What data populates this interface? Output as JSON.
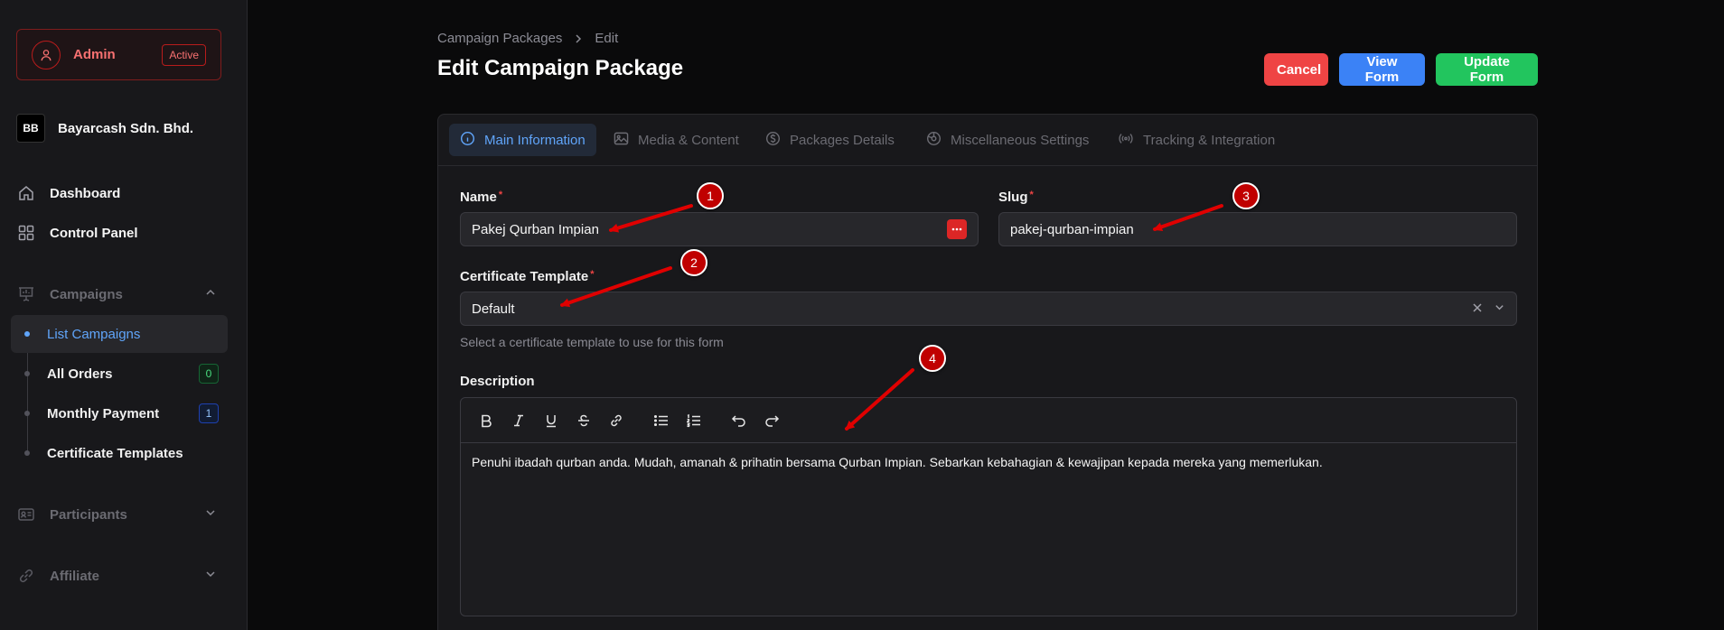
{
  "sidebar": {
    "admin": {
      "name": "Admin",
      "status": "Active"
    },
    "org": {
      "initials": "BB",
      "name": "Bayarcash Sdn. Bhd."
    },
    "nav": {
      "dashboard": "Dashboard",
      "control_panel": "Control Panel",
      "campaigns": "Campaigns",
      "participants": "Participants",
      "affiliate": "Affiliate"
    },
    "campaign_items": [
      {
        "label": "List Campaigns",
        "active": true
      },
      {
        "label": "All Orders",
        "count": "0"
      },
      {
        "label": "Monthly Payment",
        "count": "1"
      },
      {
        "label": "Certificate Templates"
      }
    ]
  },
  "header": {
    "breadcrumb": [
      "Campaign Packages",
      "Edit"
    ],
    "title": "Edit Campaign Package",
    "buttons": {
      "cancel": "Cancel",
      "view": "View Form",
      "update": "Update Form"
    }
  },
  "tabs": [
    {
      "label": "Main Information",
      "icon": "info-icon",
      "active": true
    },
    {
      "label": "Media & Content",
      "icon": "image-icon"
    },
    {
      "label": "Packages Details",
      "icon": "dollar-icon"
    },
    {
      "label": "Miscellaneous Settings",
      "icon": "settings-icon"
    },
    {
      "label": "Tracking & Integration",
      "icon": "signal-icon"
    }
  ],
  "form": {
    "name": {
      "label": "Name",
      "value": "Pakej Qurban Impian"
    },
    "slug": {
      "label": "Slug",
      "value": "pakej-qurban-impian"
    },
    "certificate": {
      "label": "Certificate Template",
      "value": "Default",
      "helper": "Select a certificate template to use for this form"
    },
    "description": {
      "label": "Description",
      "content": "Penuhi ibadah qurban anda. Mudah, amanah & prihatin bersama Qurban Impian. Sebarkan kebahagian & kewajipan kepada mereka yang memerlukan."
    }
  },
  "annotations": [
    "1",
    "2",
    "3",
    "4"
  ],
  "colors": {
    "accent": "#60a5fa",
    "danger": "#ef4444",
    "primary": "#3b82f6",
    "success": "#22c55e",
    "annotation": "#c00000"
  }
}
